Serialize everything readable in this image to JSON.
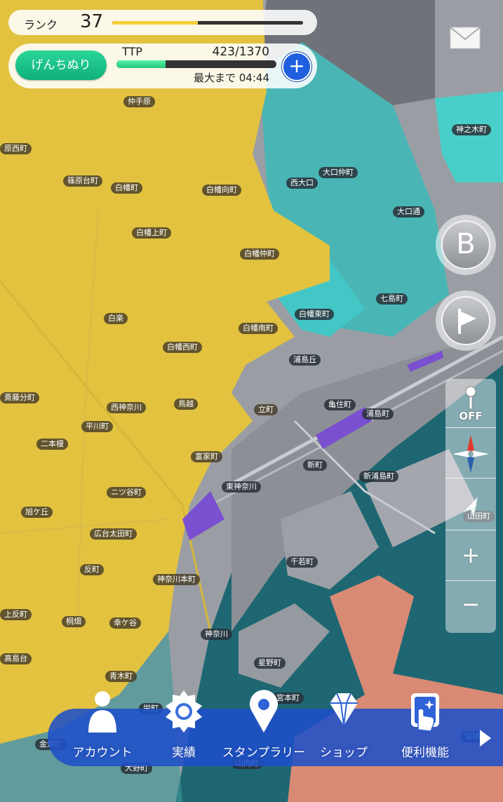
{
  "hud": {
    "rank_label": "ランク",
    "rank_value": "37",
    "rank_progress": 0.45,
    "mode_button": "げんちぬり",
    "ttp_label": "TTP",
    "ttp_value": "423/1370",
    "ttp_progress": 0.309,
    "ttp_full_time": "最大まで 04:44"
  },
  "buttons": {
    "add": "+",
    "b_button": "B",
    "location_off": "OFF",
    "zoom_in": "+",
    "zoom_out": "−"
  },
  "map_labels": [
    "仲手原",
    "原西町",
    "篠原台町",
    "白幡町",
    "白幡向町",
    "白幡上町",
    "白幡仲町",
    "西大口",
    "大口仲町",
    "大口通",
    "神之木町",
    "白幡東町",
    "七島町",
    "白楽",
    "白幡南町",
    "白幡西町",
    "浦島丘",
    "斎藤分町",
    "西神奈川",
    "鳥越",
    "立町",
    "亀住町",
    "浦島町",
    "平川町",
    "二本榎",
    "富家町",
    "新町",
    "新浦島町",
    "東神奈川",
    "ニツ谷町",
    "旭ケ丘",
    "広台太田町",
    "千若町",
    "山田町",
    "反町",
    "神奈川本町",
    "上反町",
    "桐畑",
    "幸ケ谷",
    "神奈川",
    "高島台",
    "青木町",
    "星野町",
    "栄町",
    "宮本町",
    "金港町",
    "大野町",
    "山内町",
    "瑞穂"
  ],
  "bottom_nav": [
    {
      "label": "アカウント",
      "icon": "person-icon"
    },
    {
      "label": "実績",
      "icon": "medal-icon"
    },
    {
      "label": "スタンプラリー",
      "icon": "pin-icon"
    },
    {
      "label": "ショップ",
      "icon": "diamond-icon"
    },
    {
      "label": "便利機能",
      "icon": "tap-card-icon"
    }
  ],
  "colors": {
    "territory_yellow": "#e3c33f",
    "territory_cyan": "#3ec8c4",
    "territory_orange": "#e0876c",
    "water_teal": "#1d6b75",
    "nav_blue": "#1e50c8",
    "accent_green": "#1bc48a"
  }
}
